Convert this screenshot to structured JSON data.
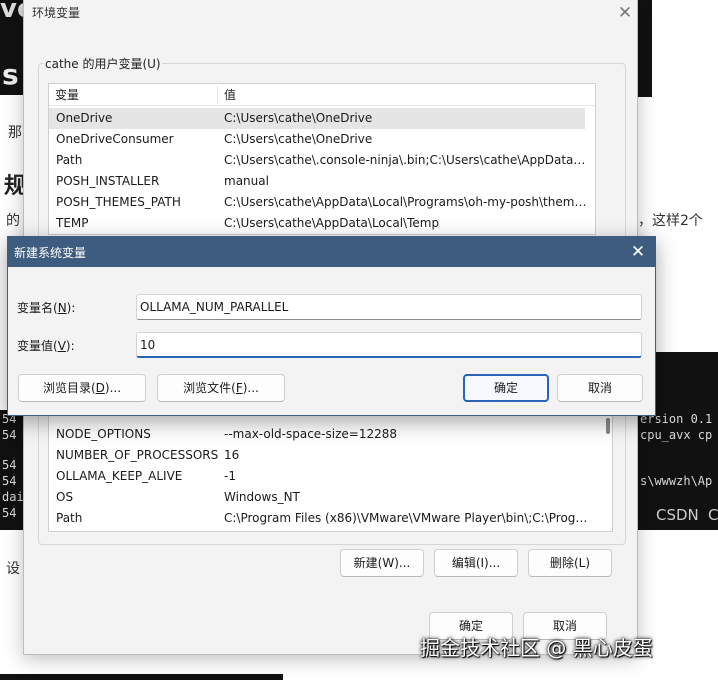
{
  "background": {
    "fragments": {
      "ve": "ve",
      "s": "s",
      "na": "那",
      "chu": "规",
      "de": "的",
      "suffix": "，这样2个",
      "she": "设",
      "csdn": "CSDN",
      "c": "C"
    },
    "terminal_lines": {
      "l1": "ersion 0.1",
      "l2": "cpu_avx cp",
      "l3": "s\\wwwzh\\Ap",
      "p1": "54",
      "p2": "54",
      "p3": "54",
      "p4": "54",
      "p5": "dai",
      "p6": "54"
    }
  },
  "env_dialog": {
    "title": "环境变量",
    "close_glyph": "✕",
    "user_group_label": "cathe 的用户变量(U)",
    "user_vars": {
      "columns": [
        "变量",
        "值"
      ],
      "rows": [
        {
          "name": "OneDrive",
          "value": "C:\\Users\\cathe\\OneDrive",
          "selected": true
        },
        {
          "name": "OneDriveConsumer",
          "value": "C:\\Users\\cathe\\OneDrive"
        },
        {
          "name": "Path",
          "value": "C:\\Users\\cathe\\.console-ninja\\.bin;C:\\Users\\cathe\\AppData\\L..."
        },
        {
          "name": "POSH_INSTALLER",
          "value": "manual"
        },
        {
          "name": "POSH_THEMES_PATH",
          "value": "C:\\Users\\cathe\\AppData\\Local\\Programs\\oh-my-posh\\themes\\"
        },
        {
          "name": "TEMP",
          "value": "C:\\Users\\cathe\\AppData\\Local\\Temp"
        }
      ]
    },
    "system_vars": {
      "rows": [
        {
          "name": "NODE_OPTIONS",
          "value": "--max-old-space-size=12288"
        },
        {
          "name": "NUMBER_OF_PROCESSORS",
          "value": "16"
        },
        {
          "name": "OLLAMA_KEEP_ALIVE",
          "value": "-1"
        },
        {
          "name": "OS",
          "value": "Windows_NT"
        },
        {
          "name": "Path",
          "value": "C:\\Program Files (x86)\\VMware\\VMware Player\\bin\\;C:\\Progr..."
        }
      ]
    },
    "buttons": {
      "new": "新建(W)...",
      "edit": "编辑(I)...",
      "delete": "删除(L)",
      "ok": "确定",
      "cancel": "取消"
    }
  },
  "new_var_dialog": {
    "title": "新建系统变量",
    "close_glyph": "✕",
    "name_label_prefix": "变量名(",
    "name_label_key": "N",
    "name_label_suffix": "):",
    "value_label_prefix": "变量值(",
    "value_label_key": "V",
    "value_label_suffix": "):",
    "name_value": "OLLAMA_NUM_PARALLEL",
    "value_value": "10",
    "buttons": {
      "browse_dir_prefix": "浏览目录(",
      "browse_dir_key": "D",
      "browse_dir_suffix": ")...",
      "browse_file_prefix": "浏览文件(",
      "browse_file_key": "F",
      "browse_file_suffix": ")...",
      "ok": "确定",
      "cancel": "取消"
    }
  },
  "watermark": "掘金技术社区 @ 黑心皮蛋"
}
